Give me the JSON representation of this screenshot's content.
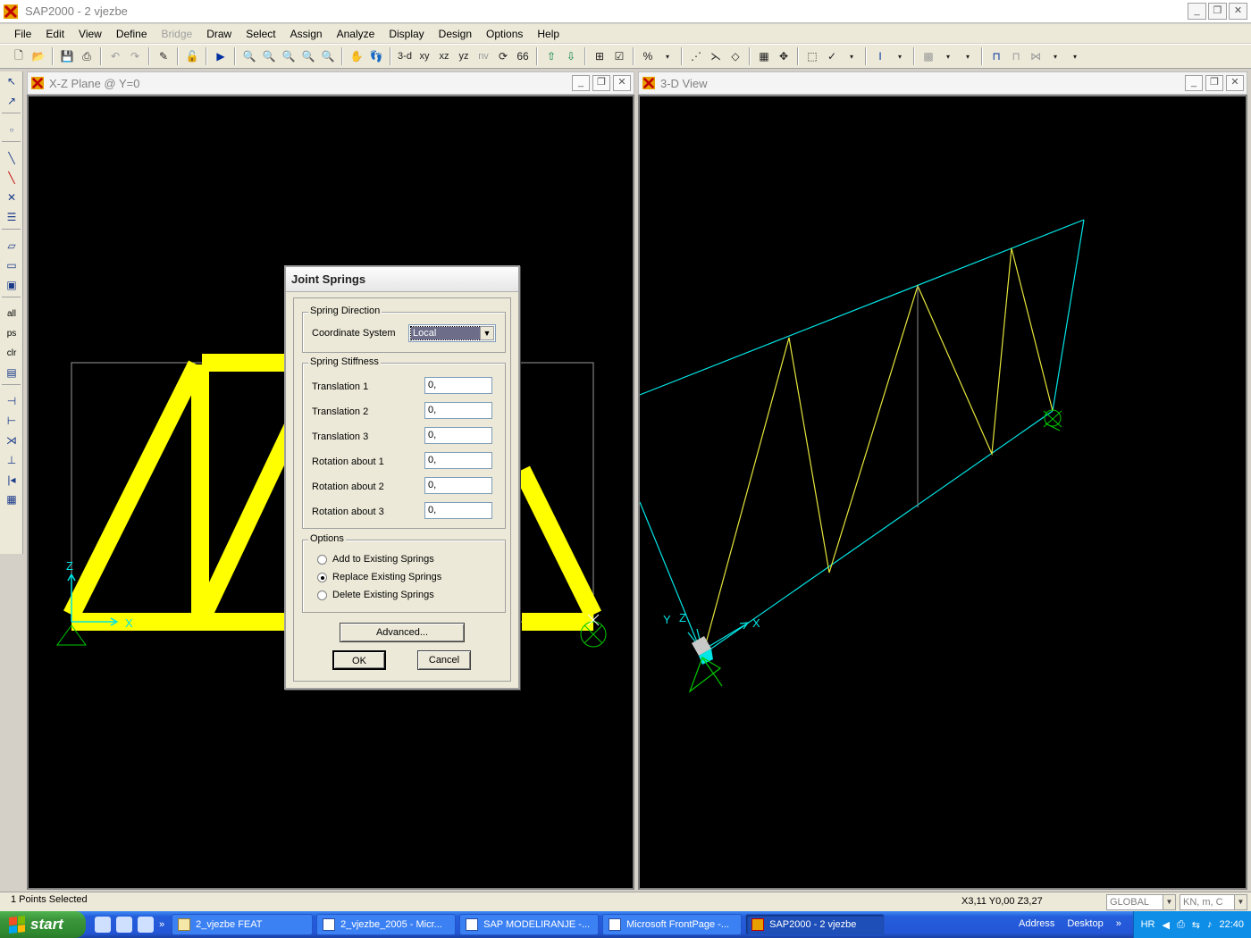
{
  "app": {
    "title": "SAP2000  -  2 vjezbe"
  },
  "window_buttons": {
    "minimize": "_",
    "restore": "❐",
    "close": "✕"
  },
  "menu": [
    "File",
    "Edit",
    "View",
    "Define",
    "Bridge",
    "Draw",
    "Select",
    "Assign",
    "Analyze",
    "Display",
    "Design",
    "Options",
    "Help"
  ],
  "menu_disabled": [
    "Bridge"
  ],
  "toolbar": {
    "view_3d": "3-d",
    "view_xy": "xy",
    "view_xz": "xz",
    "view_yz": "yz",
    "view_nv": "nv"
  },
  "left_tools": {
    "all": "all",
    "ps": "ps",
    "clr": "clr"
  },
  "view_left": {
    "title": "X-Z Plane @ Y=0",
    "axis_x": "X",
    "axis_z": "Z"
  },
  "view_right": {
    "title": "3-D View",
    "axis_x": "X",
    "axis_y": "Y",
    "axis_z": "Z"
  },
  "dialog": {
    "title": "Joint Springs",
    "spring_direction": {
      "label": "Spring Direction",
      "coord_label": "Coordinate System",
      "coord_value": "Local"
    },
    "spring_stiffness": {
      "label": "Spring Stiffness",
      "rows": [
        {
          "label": "Translation 1",
          "value": "0,"
        },
        {
          "label": "Translation 2",
          "value": "0,"
        },
        {
          "label": "Translation 3",
          "value": "0,"
        },
        {
          "label": "Rotation about 1",
          "value": "0,"
        },
        {
          "label": "Rotation about 2",
          "value": "0,"
        },
        {
          "label": "Rotation about 3",
          "value": "0,"
        }
      ]
    },
    "options": {
      "label": "Options",
      "items": [
        {
          "label": "Add to Existing Springs",
          "selected": false
        },
        {
          "label": "Replace Existing Springs",
          "selected": true
        },
        {
          "label": "Delete Existing Springs",
          "selected": false
        }
      ]
    },
    "advanced_button": "Advanced...",
    "ok_button": "OK",
    "cancel_button": "Cancel"
  },
  "status": {
    "selection": "1 Points Selected",
    "coords": "X3,11  Y0,00  Z3,27",
    "coord_system": "GLOBAL",
    "units": "KN, m, C"
  },
  "taskbar": {
    "start": "start",
    "tasks": [
      {
        "label": "2_vjezbe FEAT",
        "active": false
      },
      {
        "label": "2_vjezbe_2005 - Micr...",
        "active": false
      },
      {
        "label": "SAP  MODELIRANJE -...",
        "active": false
      },
      {
        "label": "Microsoft FrontPage -...",
        "active": false
      },
      {
        "label": "SAP2000 - 2 vjezbe",
        "active": true
      }
    ],
    "address": "Address",
    "desktop": "Desktop",
    "chevron": "»",
    "lang": "HR",
    "clock": "22:40"
  },
  "colors": {
    "truss_yellow": "#ffff00",
    "frame_cyan": "#00e5e5",
    "support_green": "#00c800",
    "view_bg": "#000000"
  }
}
